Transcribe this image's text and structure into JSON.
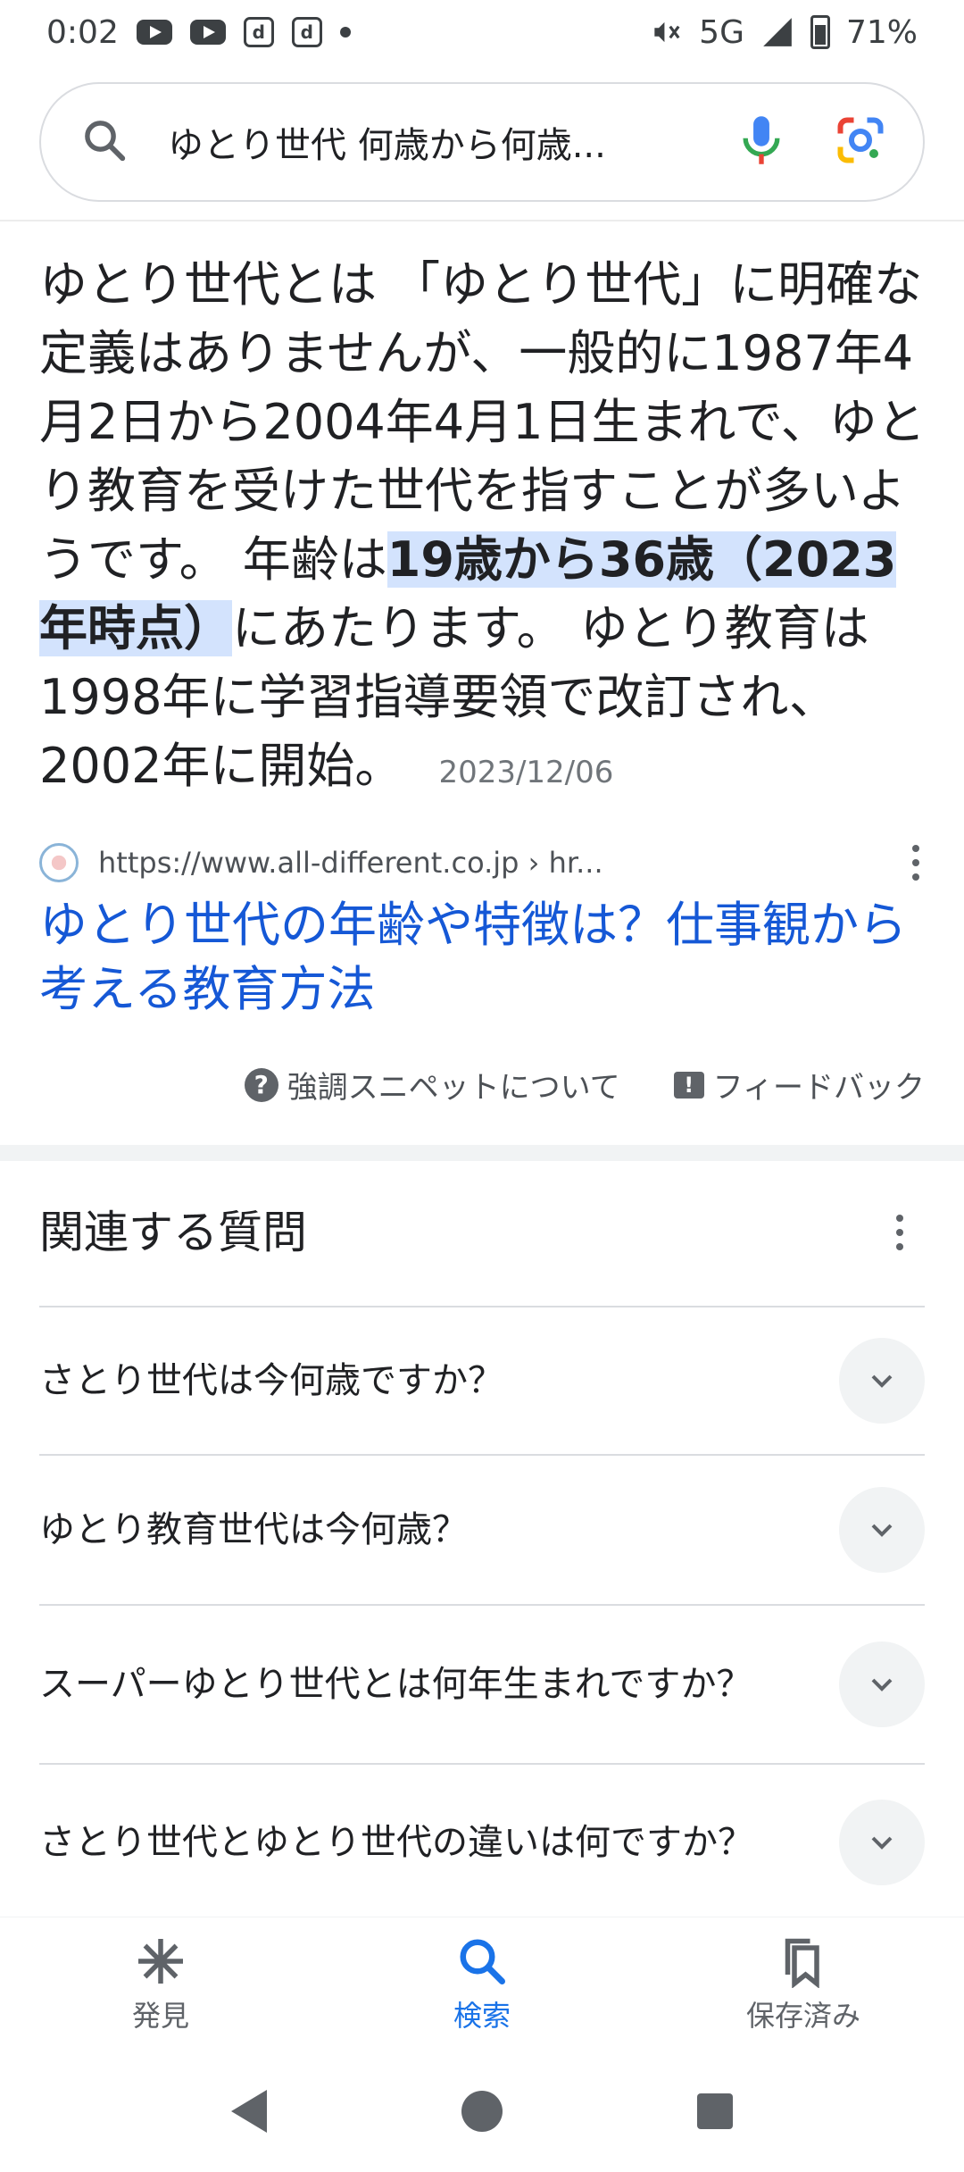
{
  "status_bar": {
    "time": "0:02",
    "network": "5G",
    "battery": "71%"
  },
  "search": {
    "query": "ゆとり世代 何歳から何歳..."
  },
  "snippet": {
    "part1": "ゆとり世代とは 「ゆとり世代」に明確な定義はありませんが、一般的に1987年4月2日から2004年4月1日生まれで、ゆとり教育を受けた世代を指すことが多いようです。 年齢は",
    "highlight": "19歳から36歳（2023年時点）",
    "part2": "にあたります。 ゆとり教育は1998年に学習指導要領で改訂され、2002年に開始。",
    "date": "2023/12/06"
  },
  "source": {
    "url": "https://www.all-different.co.jp › hr...",
    "title": "ゆとり世代の年齢や特徴は？仕事観から考える教育方法"
  },
  "snippet_footer": {
    "about_label": "強調スニペットについて",
    "feedback_label": "フィードバック"
  },
  "related": {
    "title": "関連する質問",
    "questions": [
      "さとり世代は今何歳ですか？",
      "ゆとり教育世代は今何歳？",
      "スーパーゆとり世代とは何年生まれですか？",
      "さとり世代とゆとり世代の違いは何ですか？"
    ]
  },
  "bottom_nav": {
    "discover": "発見",
    "search": "検索",
    "saved": "保存済み"
  },
  "colors": {
    "link": "#1558d6",
    "active": "#1a73e8",
    "highlight": "#d3e3fd"
  }
}
